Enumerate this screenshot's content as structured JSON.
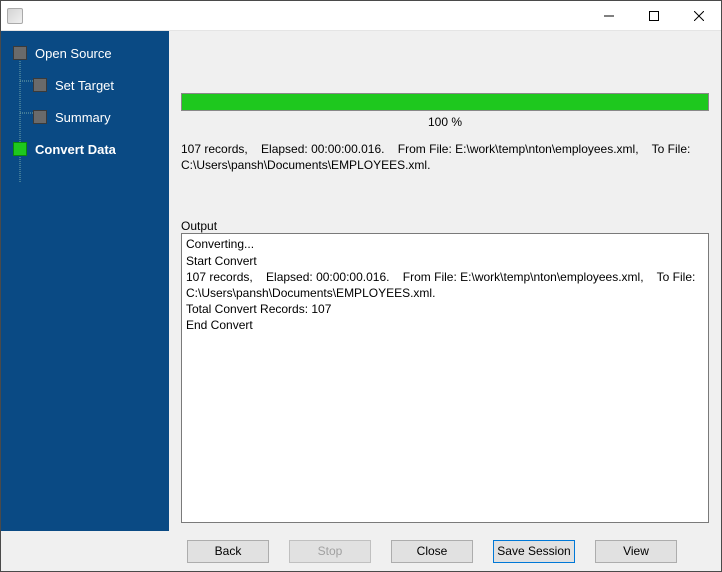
{
  "window": {
    "title": ""
  },
  "sidebar": {
    "items": [
      {
        "label": "Open Source",
        "active": false,
        "level": "root"
      },
      {
        "label": "Set Target",
        "active": false,
        "level": "child"
      },
      {
        "label": "Summary",
        "active": false,
        "level": "child"
      },
      {
        "label": "Convert Data",
        "active": true,
        "level": "root"
      }
    ]
  },
  "progress": {
    "percent_text": "100 %"
  },
  "status_text": "107 records,    Elapsed: 00:00:00.016.    From File: E:\\work\\temp\\nton\\employees.xml,    To File: C:\\Users\\pansh\\Documents\\EMPLOYEES.xml.",
  "output": {
    "label": "Output",
    "text": "Converting...\nStart Convert\n107 records,    Elapsed: 00:00:00.016.    From File: E:\\work\\temp\\nton\\employees.xml,    To File: C:\\Users\\pansh\\Documents\\EMPLOYEES.xml.\nTotal Convert Records: 107\nEnd Convert"
  },
  "buttons": {
    "back": "Back",
    "stop": "Stop",
    "close": "Close",
    "save_session": "Save Session",
    "view": "View"
  }
}
